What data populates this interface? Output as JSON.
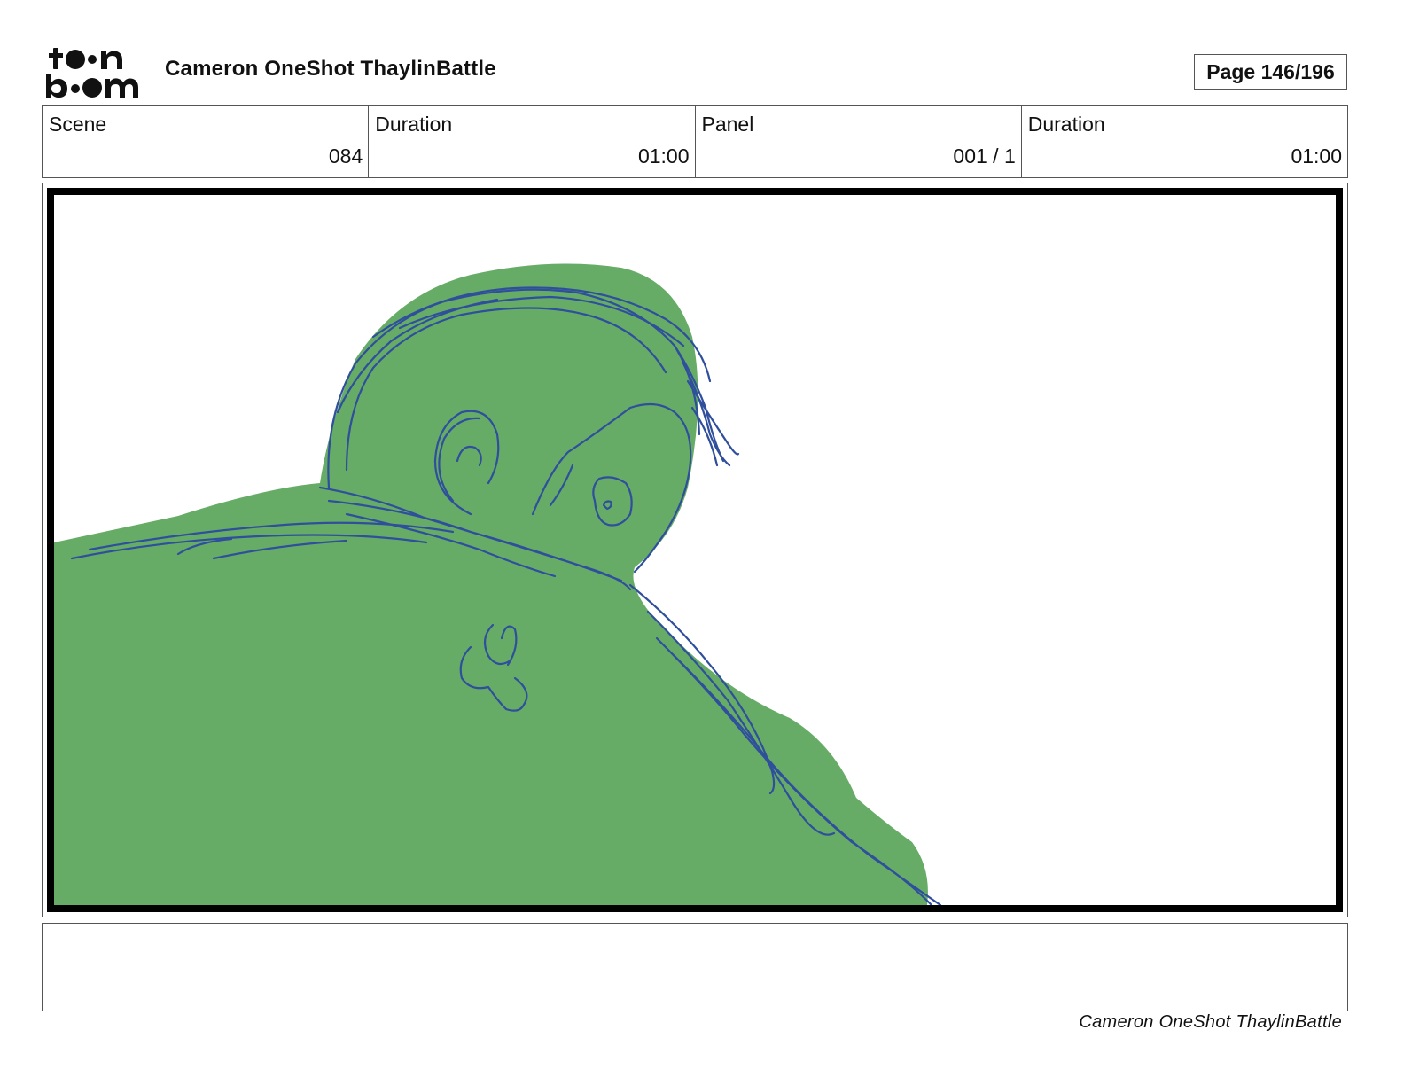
{
  "header": {
    "logo": {
      "text_top": "toon",
      "text_bottom": "boom"
    },
    "title": "Cameron OneShot ThaylinBattle",
    "page_indicator": "Page 146/196"
  },
  "info_row": [
    {
      "label": "Scene",
      "value": "084"
    },
    {
      "label": "Duration",
      "value": "01:00"
    },
    {
      "label": "Panel",
      "value": "001 / 1"
    },
    {
      "label": "Duration",
      "value": "01:00"
    }
  ],
  "panel": {
    "fill_color": "#66ac67",
    "line_color": "#2f4f9c",
    "border_color": "#000000"
  },
  "notes": {
    "text": ""
  },
  "footer": {
    "title": "Cameron OneShot ThaylinBattle"
  }
}
